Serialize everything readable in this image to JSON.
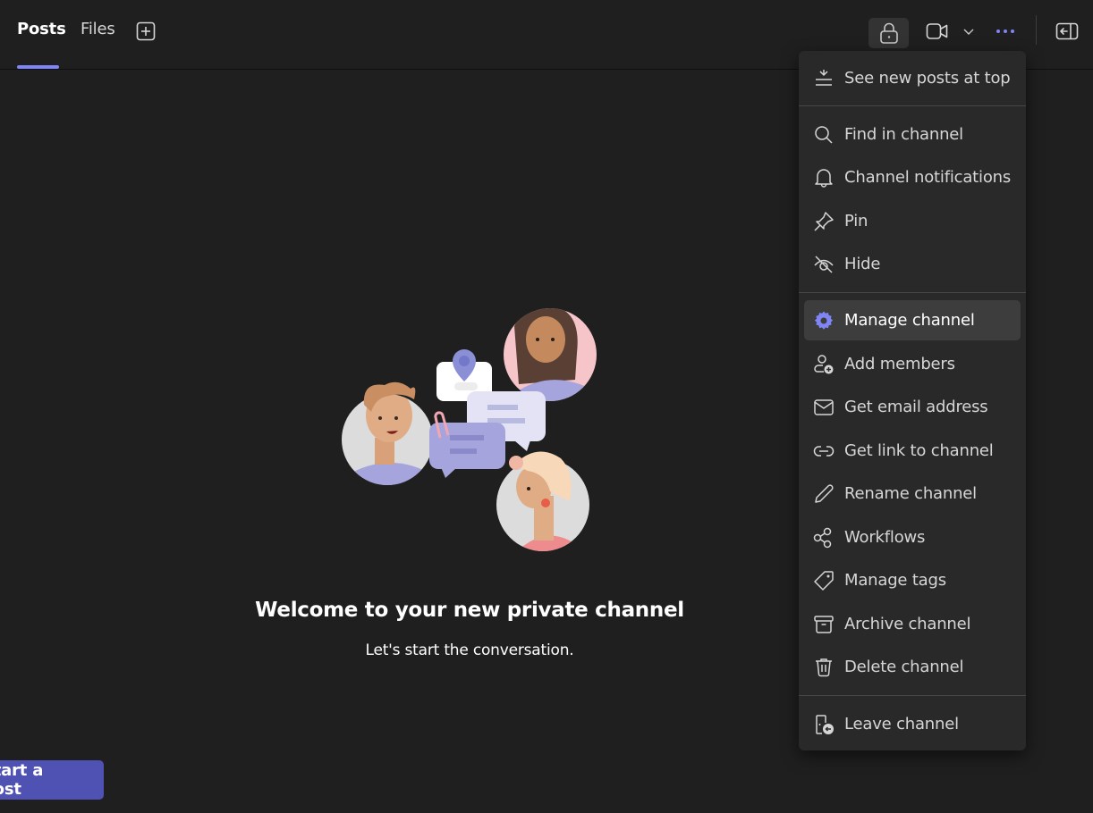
{
  "header": {
    "tabs": [
      {
        "label": "Posts",
        "active": true
      },
      {
        "label": "Files",
        "active": false
      }
    ],
    "add_tab_icon": "plus-square-icon",
    "actions": [
      {
        "name": "private-channel",
        "icon": "lock-icon"
      },
      {
        "name": "meet",
        "icon": "video-icon"
      },
      {
        "name": "meet-options",
        "icon": "chevron-down-icon"
      },
      {
        "name": "more-options",
        "icon": "more-horizontal-icon"
      },
      {
        "name": "toggle-panel",
        "icon": "panel-collapse-icon"
      }
    ],
    "accent_color": "#7f85f5"
  },
  "empty_state": {
    "title": "Welcome to your new private channel",
    "subtitle": "Let's start the conversation.",
    "illustration": "people-chatting-illustration"
  },
  "compose": {
    "start_post_label": "Start a post",
    "button_color": "#4f52b2"
  },
  "menu": {
    "groups": [
      [
        {
          "label": "See new posts at top",
          "icon": "sort-top-icon"
        }
      ],
      [
        {
          "label": "Find in channel",
          "icon": "search-icon"
        },
        {
          "label": "Channel notifications",
          "icon": "bell-icon"
        },
        {
          "label": "Pin",
          "icon": "pin-icon"
        },
        {
          "label": "Hide",
          "icon": "eye-off-icon"
        }
      ],
      [
        {
          "label": "Manage channel",
          "icon": "gear-icon",
          "highlighted": true
        },
        {
          "label": "Add members",
          "icon": "person-add-icon"
        },
        {
          "label": "Get email address",
          "icon": "mail-icon"
        },
        {
          "label": "Get link to channel",
          "icon": "link-icon"
        },
        {
          "label": "Rename channel",
          "icon": "pencil-icon"
        },
        {
          "label": "Workflows",
          "icon": "workflows-icon"
        },
        {
          "label": "Manage tags",
          "icon": "tag-icon"
        },
        {
          "label": "Archive channel",
          "icon": "archive-icon"
        },
        {
          "label": "Delete channel",
          "icon": "trash-icon"
        }
      ],
      [
        {
          "label": "Leave channel",
          "icon": "leave-door-icon"
        }
      ]
    ]
  }
}
